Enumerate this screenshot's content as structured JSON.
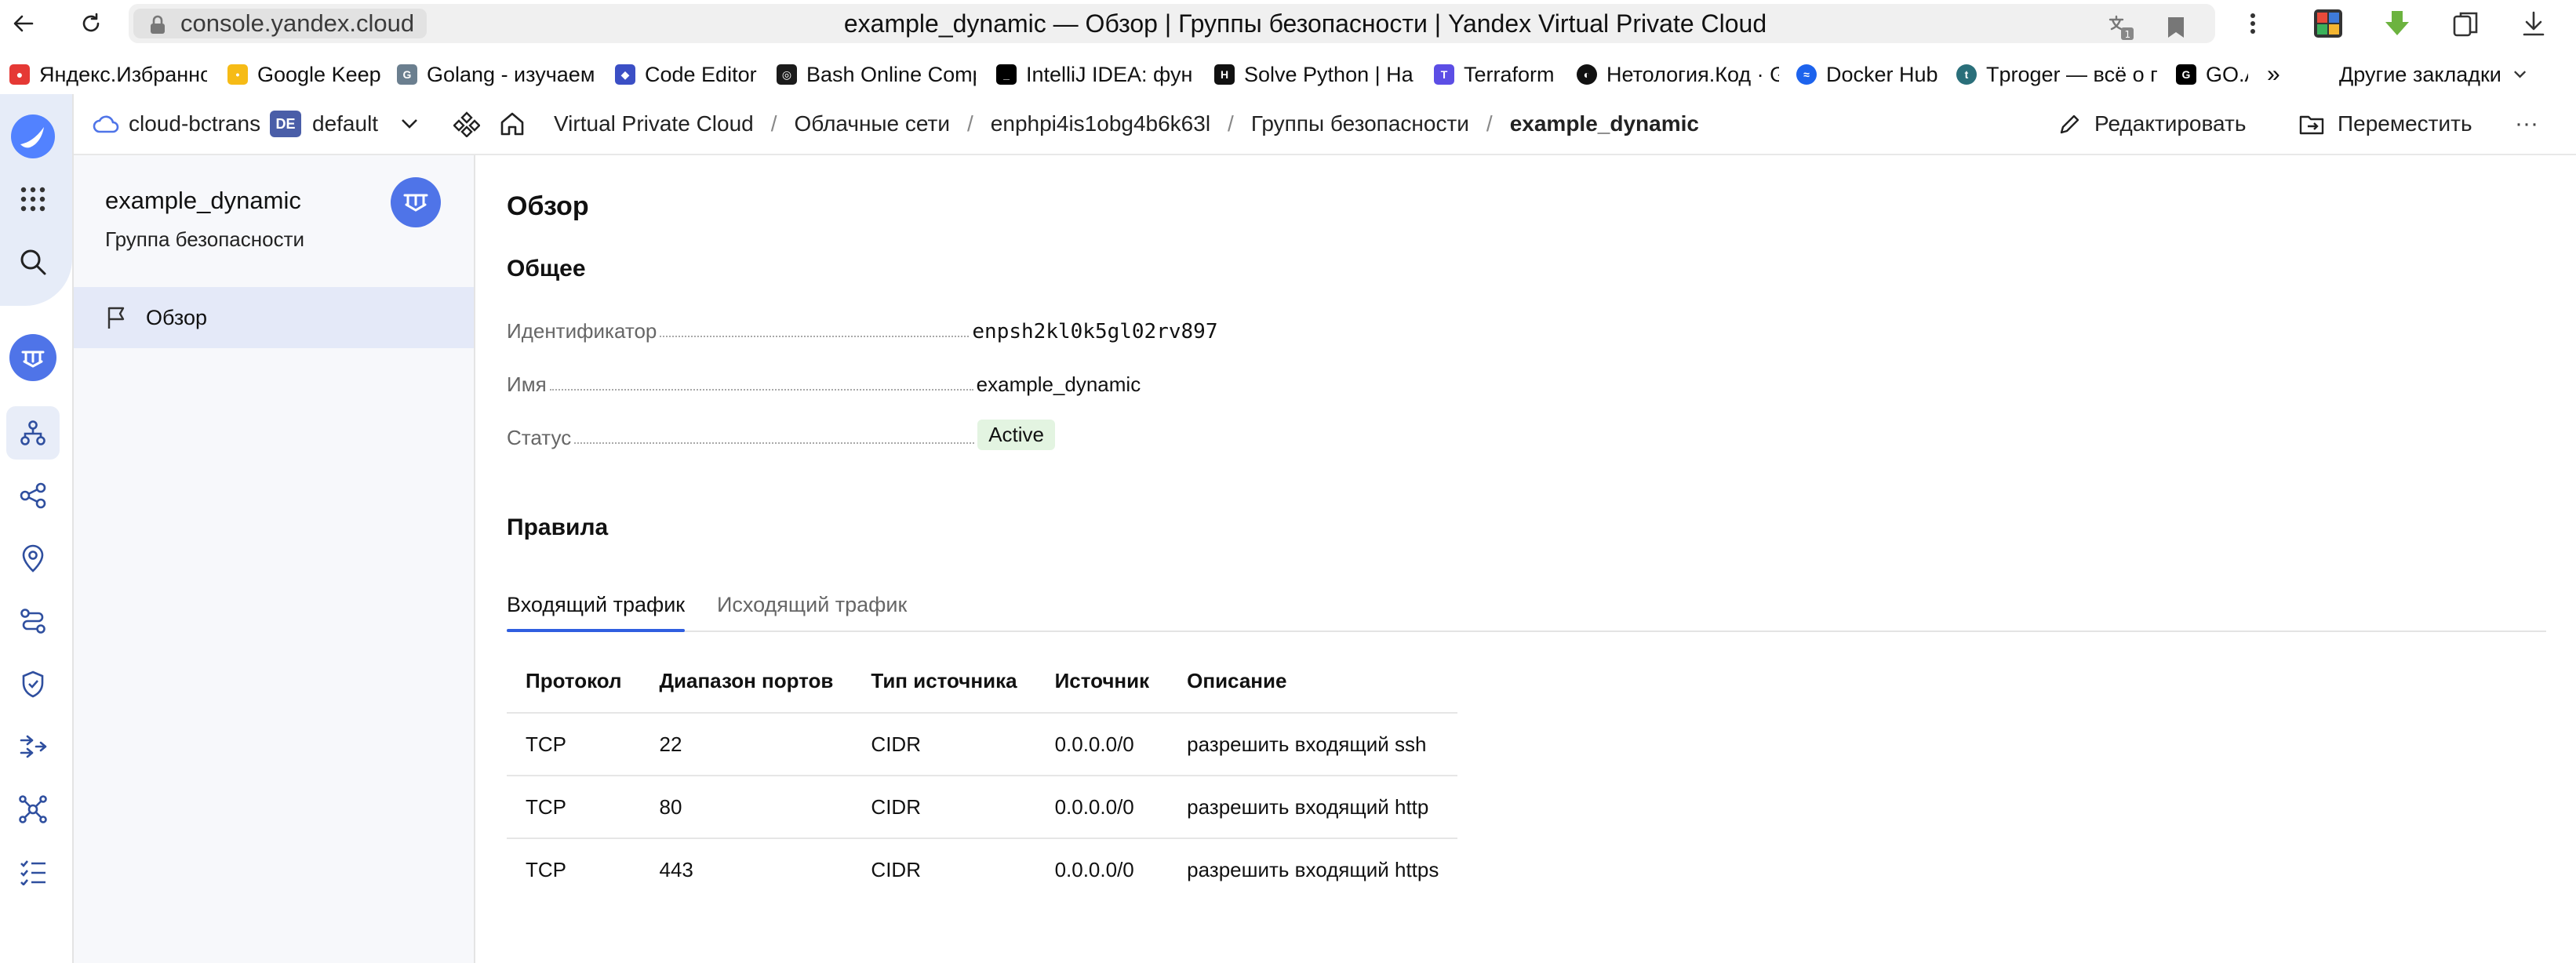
{
  "browser": {
    "url": "console.yandex.cloud",
    "tab_title": "example_dynamic — Обзор | Группы безопасности | Yandex Virtual Private Cloud"
  },
  "bookmarks": {
    "items": [
      {
        "label": "Яндекс.Избранное",
        "icon": "yandex-collections-icon",
        "color": "#e53935"
      },
      {
        "label": "Google Keep",
        "icon": "google-keep-icon",
        "color": "#f6bb16"
      },
      {
        "label": "Golang - изучаем",
        "icon": "gopher-icon",
        "color": "#6b7f8f"
      },
      {
        "label": "Code Editor",
        "icon": "code-editor-icon",
        "color": "#3b4fc5"
      },
      {
        "label": "Bash Online Compiler",
        "icon": "bash-icon",
        "color": "#1b1b1b"
      },
      {
        "label": "IntelliJ IDEA: функции",
        "icon": "intellij-icon",
        "color": "#000000"
      },
      {
        "label": "Solve Python | HackerRank",
        "icon": "hackerrank-icon",
        "color": "#111111"
      },
      {
        "label": "Terraform",
        "icon": "terraform-icon",
        "color": "#5c4ee5"
      },
      {
        "label": "Нетология.Код · GitHub",
        "icon": "github-icon",
        "color": "#111111"
      },
      {
        "label": "Docker Hub",
        "icon": "docker-icon",
        "color": "#1d63ed"
      },
      {
        "label": "Tproger — всё о программировании",
        "icon": "tproger-icon",
        "color": "#2a6f7a"
      },
      {
        "label": "GO.A",
        "icon": "goa-icon",
        "color": "#000000"
      }
    ],
    "more": "»",
    "other": "Другие закладки"
  },
  "header": {
    "cloud": "cloud-bctrans",
    "folder_badge": "DE",
    "folder": "default",
    "breadcrumbs": [
      "Virtual Private Cloud",
      "Облачные сети",
      "enphpi4is1obg4b6k63l",
      "Группы безопасности",
      "example_dynamic"
    ],
    "separator": "/",
    "edit": "Редактировать",
    "move": "Переместить",
    "more": "···"
  },
  "sidenav": {
    "title": "example_dynamic",
    "subtitle": "Группа безопасности",
    "items": [
      {
        "label": "Обзор",
        "icon": "flag-icon"
      }
    ]
  },
  "main": {
    "title": "Обзор",
    "general_heading": "Общее",
    "fields": {
      "id_label": "Идентификатор",
      "id_value": "enpsh2kl0k5gl02rv897",
      "name_label": "Имя",
      "name_value": "example_dynamic",
      "status_label": "Статус",
      "status_value": "Active"
    },
    "rules_heading": "Правила",
    "tabs": [
      "Входящий трафик",
      "Исходящий трафик"
    ],
    "table": {
      "headers": [
        "Протокол",
        "Диапазон портов",
        "Тип источника",
        "Источник",
        "Описание"
      ],
      "rows": [
        [
          "TCP",
          "22",
          "CIDR",
          "0.0.0.0/0",
          "разрешить входящий ssh"
        ],
        [
          "TCP",
          "80",
          "CIDR",
          "0.0.0.0/0",
          "разрешить входящий http"
        ],
        [
          "TCP",
          "443",
          "CIDR",
          "0.0.0.0/0",
          "разрешить входящий https"
        ]
      ]
    }
  },
  "colors": {
    "accent": "#2f5ee0",
    "status_bg": "#e3f4e1",
    "status_fg": "#2b7a2b",
    "sidebar_active": "#e4e9f8",
    "avatar": "#4f74e8"
  }
}
